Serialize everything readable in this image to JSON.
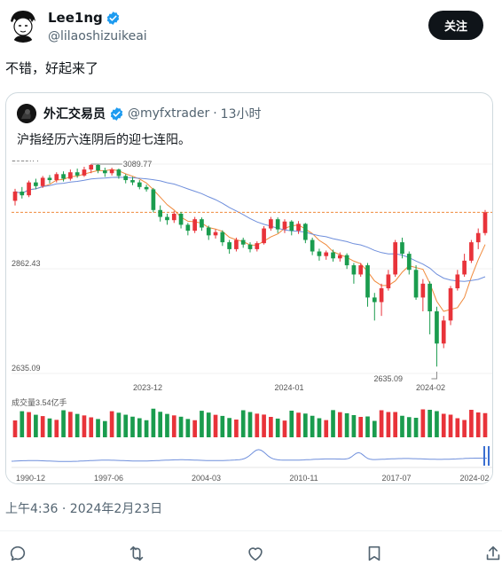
{
  "tweet": {
    "author": {
      "name": "Lee1ng",
      "handle": "@lilaoshizuikeai",
      "verified": true
    },
    "follow_label": "关注",
    "text": "不错，好起来了",
    "timestamp": "上午4:36 · 2024年2月23日"
  },
  "quote": {
    "author": {
      "name": "外汇交易员",
      "handle": "@myfxtrader",
      "separator": "·",
      "time": "13小时",
      "verified": true
    },
    "text": "沪指经历六连阴后的迎七连阳。"
  },
  "colors": {
    "up": "#e8333a",
    "down": "#1a9c4e",
    "ma_blue": "#6f8fdc",
    "ma_orange": "#f08a3c",
    "verified": "#1d9bf0",
    "ref_line": "#f08a3c"
  },
  "actions": [
    "reply-icon",
    "retweet-icon",
    "like-icon",
    "bookmark-icon",
    "share-icon"
  ],
  "chart_data": {
    "type": "candlestick",
    "price_labels": [
      "3089.77",
      "2862.43",
      "2635.09"
    ],
    "price_range": [
      2635.09,
      3089.77
    ],
    "high_annotation": "3089.77",
    "low_annotation": "2635.09",
    "x_tick_labels": [
      "2023-12",
      "2024-01",
      "2024-02"
    ],
    "volume_label": "成交量3.54亿手",
    "overview_tick_labels": [
      "1990-12",
      "1997-06",
      "2004-03",
      "2010-11",
      "2017-07",
      "2024-02"
    ],
    "candles": [
      [
        3010,
        3030,
        3000,
        3036
      ],
      [
        3030,
        3022,
        3015,
        3040
      ],
      [
        3022,
        3050,
        3018,
        3054
      ],
      [
        3050,
        3042,
        3035,
        3058
      ],
      [
        3042,
        3060,
        3038,
        3064
      ],
      [
        3060,
        3055,
        3048,
        3066
      ],
      [
        3055,
        3068,
        3050,
        3072
      ],
      [
        3068,
        3058,
        3052,
        3074
      ],
      [
        3058,
        3072,
        3054,
        3078
      ],
      [
        3072,
        3065,
        3060,
        3080
      ],
      [
        3065,
        3078,
        3062,
        3084
      ],
      [
        3078,
        3088,
        3070,
        3090
      ],
      [
        3088,
        3076,
        3070,
        3090
      ],
      [
        3076,
        3070,
        3062,
        3082
      ],
      [
        3070,
        3078,
        3065,
        3082
      ],
      [
        3078,
        3064,
        3058,
        3080
      ],
      [
        3064,
        3055,
        3048,
        3068
      ],
      [
        3055,
        3050,
        3044,
        3062
      ],
      [
        3050,
        3040,
        3035,
        3055
      ],
      [
        3040,
        3035,
        3030,
        3045
      ],
      [
        3035,
        2990,
        2985,
        3038
      ],
      [
        2990,
        2975,
        2965,
        3000
      ],
      [
        2975,
        2968,
        2958,
        2982
      ],
      [
        2968,
        2982,
        2962,
        2988
      ],
      [
        2982,
        2958,
        2950,
        2986
      ],
      [
        2958,
        2945,
        2935,
        2962
      ],
      [
        2945,
        2970,
        2940,
        2975
      ],
      [
        2970,
        2952,
        2945,
        2974
      ],
      [
        2952,
        2935,
        2925,
        2956
      ],
      [
        2935,
        2942,
        2928,
        2948
      ],
      [
        2942,
        2920,
        2912,
        2946
      ],
      [
        2920,
        2905,
        2895,
        2925
      ],
      [
        2905,
        2925,
        2900,
        2930
      ],
      [
        2925,
        2915,
        2908,
        2930
      ],
      [
        2915,
        2905,
        2898,
        2920
      ],
      [
        2905,
        2918,
        2900,
        2922
      ],
      [
        2918,
        2950,
        2915,
        2955
      ],
      [
        2950,
        2970,
        2945,
        2975
      ],
      [
        2970,
        2948,
        2940,
        2974
      ],
      [
        2948,
        2965,
        2940,
        2970
      ],
      [
        2965,
        2945,
        2935,
        2968
      ],
      [
        2945,
        2960,
        2938,
        2966
      ],
      [
        2960,
        2925,
        2918,
        2962
      ],
      [
        2925,
        2900,
        2892,
        2930
      ],
      [
        2900,
        2890,
        2880,
        2906
      ],
      [
        2890,
        2898,
        2882,
        2902
      ],
      [
        2898,
        2885,
        2878,
        2904
      ],
      [
        2885,
        2892,
        2878,
        2898
      ],
      [
        2892,
        2870,
        2862,
        2896
      ],
      [
        2870,
        2850,
        2830,
        2875
      ],
      [
        2850,
        2870,
        2845,
        2875
      ],
      [
        2870,
        2800,
        2780,
        2875
      ],
      [
        2800,
        2790,
        2750,
        2810
      ],
      [
        2790,
        2820,
        2760,
        2830
      ],
      [
        2820,
        2850,
        2815,
        2860
      ],
      [
        2850,
        2920,
        2845,
        2925
      ],
      [
        2920,
        2895,
        2885,
        2930
      ],
      [
        2895,
        2860,
        2850,
        2900
      ],
      [
        2860,
        2800,
        2795,
        2870
      ],
      [
        2800,
        2830,
        2770,
        2840
      ],
      [
        2830,
        2770,
        2720,
        2835
      ],
      [
        2770,
        2700,
        2650,
        2780
      ],
      [
        2700,
        2750,
        2690,
        2760
      ],
      [
        2750,
        2820,
        2740,
        2825
      ],
      [
        2820,
        2850,
        2815,
        2860
      ],
      [
        2850,
        2880,
        2845,
        2895
      ],
      [
        2880,
        2920,
        2875,
        2925
      ],
      [
        2920,
        2940,
        2905,
        2950
      ],
      [
        2940,
        2985,
        2935,
        2990
      ]
    ]
  }
}
